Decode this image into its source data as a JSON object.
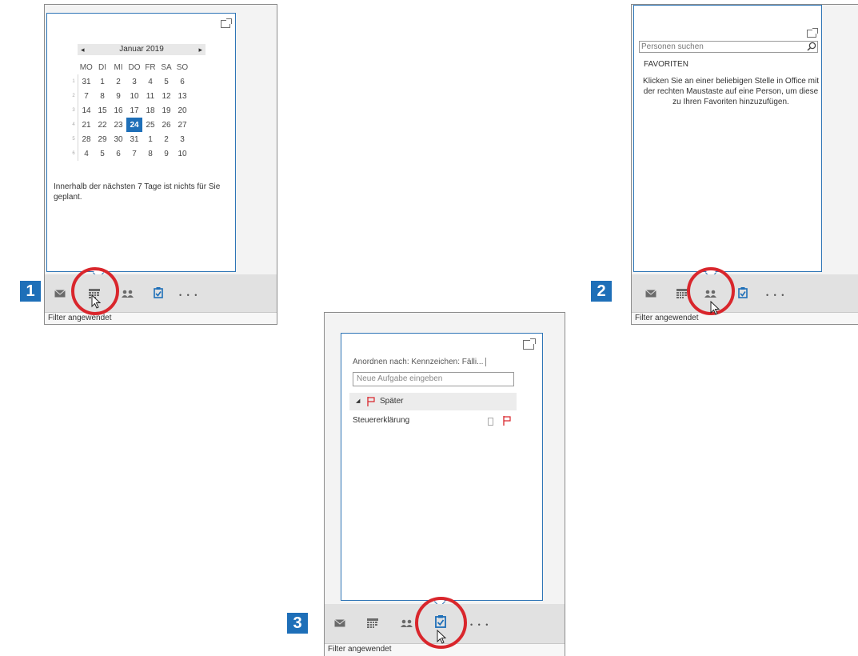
{
  "panel1": {
    "badge": "1",
    "calendar": {
      "month": "Januar 2019",
      "prev": "◂",
      "next": "▸",
      "weekdays": [
        "MO",
        "DI",
        "MI",
        "DO",
        "FR",
        "SA",
        "SO"
      ],
      "weeks": [
        {
          "wk": "1",
          "days": [
            "31",
            "1",
            "2",
            "3",
            "4",
            "5",
            "6"
          ]
        },
        {
          "wk": "2",
          "days": [
            "7",
            "8",
            "9",
            "10",
            "11",
            "12",
            "13"
          ]
        },
        {
          "wk": "3",
          "days": [
            "14",
            "15",
            "16",
            "17",
            "18",
            "19",
            "20"
          ]
        },
        {
          "wk": "4",
          "days": [
            "21",
            "22",
            "23",
            "24",
            "25",
            "26",
            "27"
          ]
        },
        {
          "wk": "5",
          "days": [
            "28",
            "29",
            "30",
            "31",
            "1",
            "2",
            "3"
          ]
        },
        {
          "wk": "6",
          "days": [
            "4",
            "5",
            "6",
            "7",
            "8",
            "9",
            "10"
          ]
        }
      ],
      "selected_day": "24"
    },
    "message": "Innerhalb der nächsten 7 Tage ist nichts für Sie geplant.",
    "status": "Filter angewendet"
  },
  "panel2": {
    "badge": "2",
    "search_placeholder": "Personen suchen",
    "favorites_heading": "FAVORITEN",
    "favorites_message": "Klicken Sie an einer beliebigen Stelle in Office mit der rechten Maustaste auf eine Person, um diese zu Ihren Favoriten hinzuzufügen.",
    "status": "Filter angewendet"
  },
  "panel3": {
    "badge": "3",
    "arrange_label": "Anordnen nach: Kennzeichen: Fälli...",
    "new_task_placeholder": "Neue Aufgabe eingeben",
    "group_label": "Später",
    "task_name": "Steuererklärung",
    "status": "Filter angewendet"
  },
  "more_label": "• • •",
  "icons": [
    "mail-icon",
    "calendar-icon",
    "people-icon",
    "tasks-icon",
    "more-icon",
    "popout-icon",
    "search-icon",
    "flag-icon",
    "cursor-icon"
  ],
  "colors": {
    "accent": "#1e6fb8",
    "highlight_ring": "#d9262c",
    "flag": "#d9262c",
    "peek_border": "#2e75b6"
  }
}
